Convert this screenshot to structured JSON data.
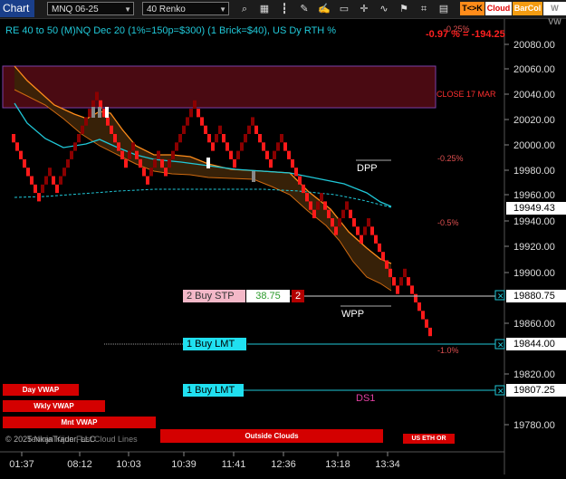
{
  "toolbar": {
    "title": "Chart",
    "instrument": "MNQ 06-25",
    "bar_type": "40 Renko",
    "buttons": [
      {
        "label": "T<>K",
        "bg": "#ff8c1a",
        "fg": "#000"
      },
      {
        "label": "Cloud",
        "bg": "#ffffff",
        "fg": "#e00000"
      },
      {
        "label": "BarCol",
        "bg": "#f39c12",
        "fg": "#fff"
      },
      {
        "label": "W VW",
        "bg": "#ffffff",
        "fg": "#888"
      }
    ],
    "icons": [
      "search-icon",
      "calendar-icon",
      "bar-style-icon",
      "properties-icon",
      "drawing-icon",
      "zoom-icon",
      "crosshair-icon",
      "indicators-icon",
      "strategy-icon",
      "lock-icon",
      "layout-icon"
    ]
  },
  "header": {
    "description": "RE 40 to 50 (M)NQ Dec 20 (1%=150p=$300) (1 Brick=$40), US Dy RTH %",
    "pnl_top": "-0.25%",
    "pnl": "-0.97 % = -194.25"
  },
  "colors": {
    "up_brick": "#8b0000",
    "down_brick": "#ff1a1a",
    "cloud_fill": "#3a2308",
    "cloud_edge": "#ff8c1a",
    "ma_line": "#20c8d8",
    "close_zone": "#4a0a12",
    "close_zone_border": "#7a3fa8",
    "axis_bg": "#000000",
    "price_box_bg": "#ffffff"
  },
  "annotations": {
    "close_label": "CLOSE 17 MAR",
    "pct_lines": [
      "-0.25%",
      "-0.5%",
      "-1.0%"
    ],
    "pivots": [
      "DPP",
      "WPP",
      "DS1"
    ]
  },
  "orders": [
    {
      "label": "2 Buy STP",
      "price": "38.75",
      "qty": "2",
      "axis_price": "19880.75"
    },
    {
      "label": "1 Buy LMT",
      "axis_price": "19844.00"
    },
    {
      "label": "1 Buy LMT",
      "axis_price": "19807.25"
    }
  ],
  "current_price": "19949.43",
  "y_axis": {
    "ticks": [
      "20080.00",
      "20060.00",
      "20040.00",
      "20020.00",
      "20000.00",
      "19980.00",
      "19960.00",
      "19940.00",
      "19920.00",
      "19900.00",
      "19860.00",
      "19820.00",
      "19780.00"
    ]
  },
  "x_axis": {
    "ticks": [
      "01:37",
      "08:12",
      "10:03",
      "10:39",
      "11:41",
      "12:36",
      "13:18",
      "13:34"
    ]
  },
  "bottom_buttons": {
    "day_vwap": "Day VWAP",
    "wkly_vwap": "Wkly VWAP",
    "mnt_vwap": "Mnt VWAP",
    "outside_clouds": "Outside Clouds",
    "us_eth_or": "US ETH OR",
    "copyright": "© 2025 NinjaTrader, LLC",
    "mkt_levels": "Tenkan Kijun Fast Cloud Lines"
  }
}
